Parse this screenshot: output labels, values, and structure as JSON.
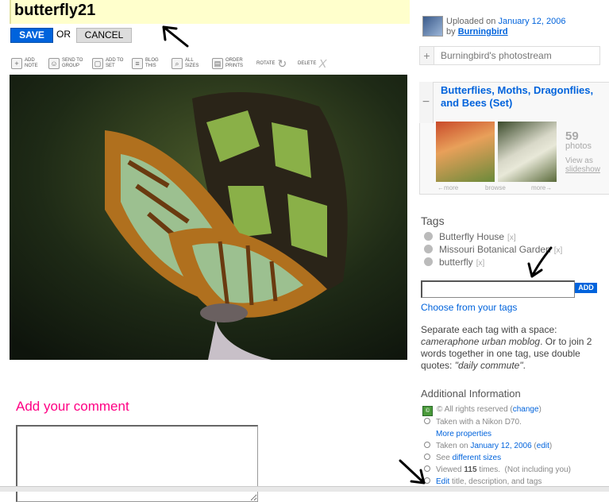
{
  "title": "butterfly21",
  "edit_controls": {
    "save_label": "SAVE",
    "or_label": "OR",
    "cancel_label": "CANCEL"
  },
  "toolbar": [
    {
      "icon": "plus-icon",
      "label": "ADD NOTE"
    },
    {
      "icon": "group-icon",
      "label": "SEND TO GROUP"
    },
    {
      "icon": "set-icon",
      "label": "ADD TO SET"
    },
    {
      "icon": "blog-icon",
      "label": "BLOG THIS"
    },
    {
      "icon": "magnifier-icon",
      "label": "ALL SIZES"
    },
    {
      "icon": "printer-icon",
      "label": "ORDER PRINTS"
    },
    {
      "icon": "rotate-icon",
      "label": "ROTATE"
    },
    {
      "icon": "delete-icon",
      "label": "DELETE"
    }
  ],
  "comment": {
    "heading": "Add your comment"
  },
  "sidebar": {
    "uploaded_prefix": "Uploaded on",
    "uploaded_date": "January 12, 2006",
    "by_prefix": "by",
    "uploader": "Burningbird",
    "photostream_label": "Burningbird's photostream",
    "set": {
      "title": "Butterflies, Moths, Dragonflies, and Bees (Set)",
      "count": "59",
      "count_label": "photos",
      "view_as": "View as",
      "slideshow": "slideshow",
      "nav_more_left": "←more",
      "nav_browse": "browse",
      "nav_more_right": "more→"
    },
    "tags": {
      "heading": "Tags",
      "items": [
        {
          "label": "Butterfly House",
          "remove": "[x]"
        },
        {
          "label": "Missouri Botanical Garden",
          "remove": "[x]"
        },
        {
          "label": "butterfly",
          "remove": "[x]"
        }
      ],
      "add_label": "ADD",
      "choose_link": "Choose from your tags",
      "help_1": "Separate each tag with a space: ",
      "help_example_1": "cameraphone urban moblog",
      "help_2": ". Or to join 2 words together in one tag, use double quotes: ",
      "help_example_2": "\"daily commute\"",
      "help_3": "."
    },
    "additional": {
      "heading": "Additional Information",
      "rights_prefix": "© All rights reserved (",
      "rights_change": "change",
      "rights_suffix": ")",
      "camera": "Taken with a Nikon D70.",
      "more_properties": "More properties",
      "taken_prefix": "Taken on ",
      "taken_date": "January 12, 2006",
      "taken_edit": "edit",
      "see_prefix": "See ",
      "see_link": "different sizes",
      "viewed_prefix": "Viewed ",
      "viewed_count": "115",
      "viewed_suffix": " times.  (Not including you)",
      "edit_link": "Edit",
      "edit_suffix": " title, description, and tags"
    }
  },
  "colors": {
    "accent": "#0063dc",
    "comment_heading": "#ff0084",
    "title_bg": "#ffffcc"
  }
}
